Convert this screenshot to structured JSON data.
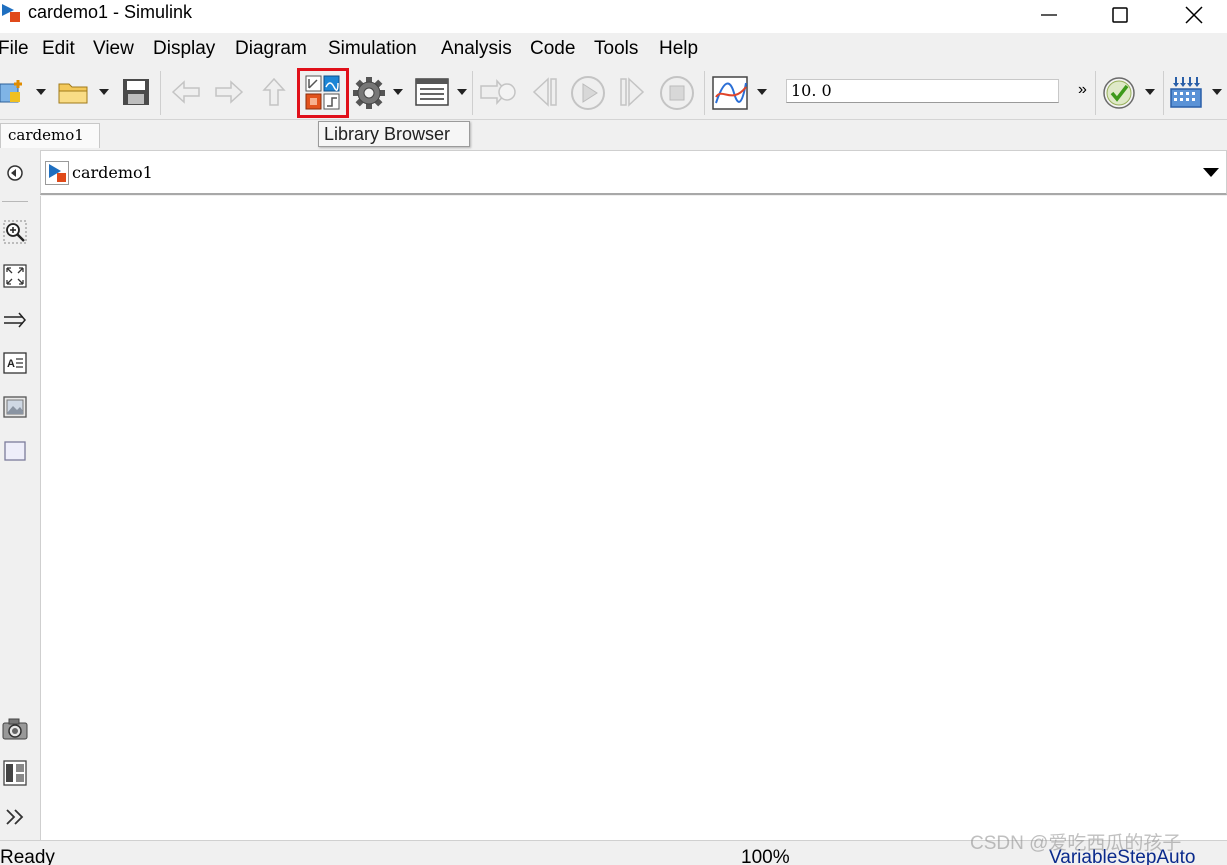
{
  "window": {
    "title": "cardemo1 - Simulink"
  },
  "menu": [
    "File",
    "Edit",
    "View",
    "Display",
    "Diagram",
    "Simulation",
    "Analysis",
    "Code",
    "Tools",
    "Help"
  ],
  "toolbar": {
    "stop_time": "10. 0",
    "more": "»",
    "tooltip": "Library Browser"
  },
  "tab": {
    "label": "cardemo1"
  },
  "address": {
    "path": "cardemo1"
  },
  "status": {
    "state": "Ready",
    "zoom": "100%",
    "solver": "VariableStepAuto"
  },
  "watermark": "CSDN @爱吃西瓜的孩子",
  "colors": {
    "highlight": "#e0101a",
    "solver_text": "#0a2a8c"
  }
}
